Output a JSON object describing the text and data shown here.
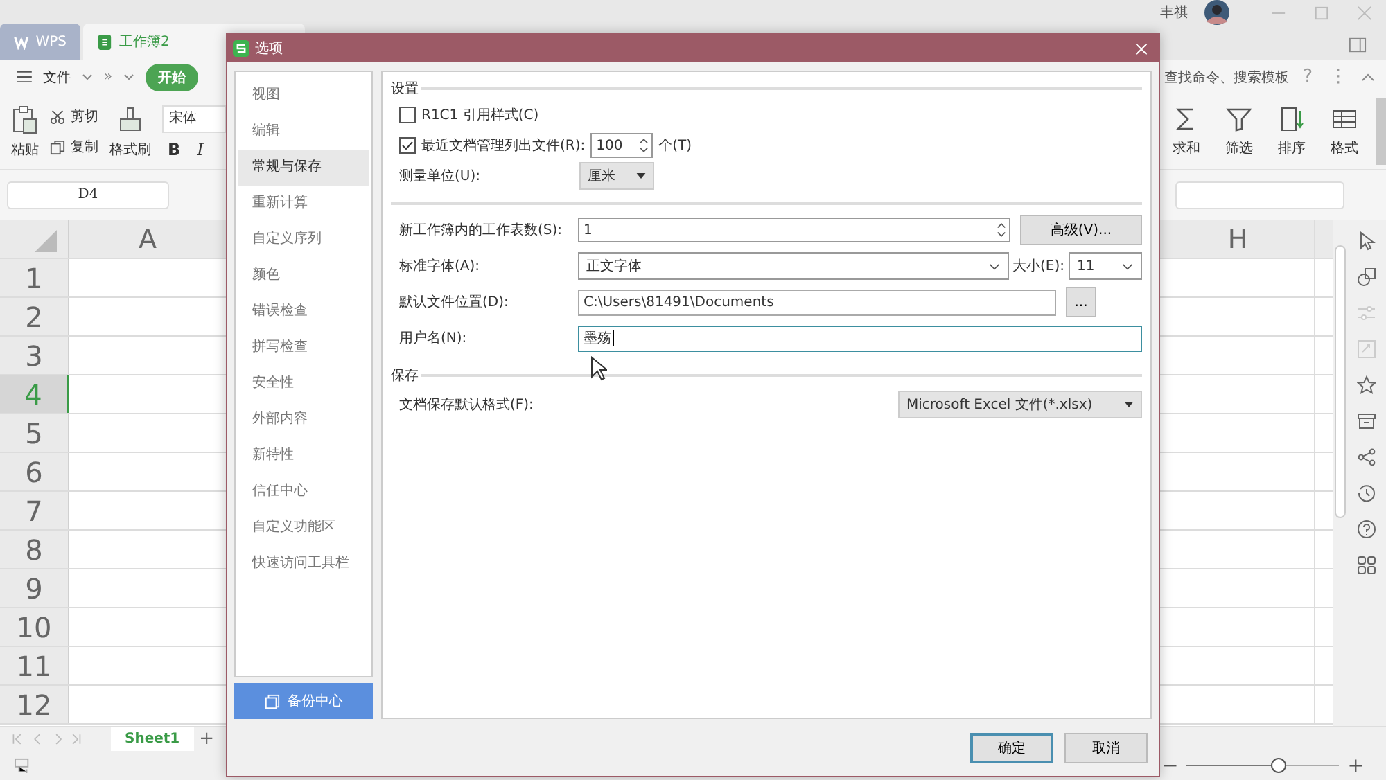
{
  "app": {
    "tabs": [
      {
        "label": "WPS",
        "kind": "home",
        "selected": false
      },
      {
        "label": "工作簿2",
        "kind": "sheet",
        "selected": true
      }
    ],
    "user": "丰祺",
    "menu": {
      "file": "文件",
      "more": "»",
      "start": "开始",
      "search": "查找命令、搜索模板",
      "help": "?",
      "options": "⋮"
    },
    "clipboard": {
      "paste": "粘贴",
      "cut": "剪切",
      "copy": "复制",
      "format_painter": "格式刷"
    },
    "font": {
      "name": "宋体",
      "bold": "B",
      "italic": "I"
    },
    "tools": [
      {
        "label": "求和",
        "kind": "sum"
      },
      {
        "label": "筛选",
        "kind": "filter"
      },
      {
        "label": "排序",
        "kind": "sort"
      },
      {
        "label": "格式",
        "kind": "format"
      }
    ],
    "name_box": "D4",
    "columns": [
      "A",
      "H"
    ],
    "rows": [
      {
        "label": "1",
        "selected": false
      },
      {
        "label": "2",
        "selected": false
      },
      {
        "label": "3",
        "selected": false
      },
      {
        "label": "4",
        "selected": true
      },
      {
        "label": "5",
        "selected": false
      },
      {
        "label": "6",
        "selected": false
      },
      {
        "label": "7",
        "selected": false
      },
      {
        "label": "8",
        "selected": false
      },
      {
        "label": "9",
        "selected": false
      },
      {
        "label": "10",
        "selected": false
      },
      {
        "label": "11",
        "selected": false
      },
      {
        "label": "12",
        "selected": false
      }
    ],
    "sheets": [
      {
        "label": "Sheet1",
        "selected": true
      }
    ],
    "add_sheet": "+",
    "zoom": {
      "minus": "−",
      "plus": "+",
      "level": 0.6
    }
  },
  "dialog": {
    "title": "选项",
    "nav": [
      {
        "label": "视图",
        "selected": false
      },
      {
        "label": "编辑",
        "selected": false
      },
      {
        "label": "常规与保存",
        "selected": true
      },
      {
        "label": "重新计算",
        "selected": false
      },
      {
        "label": "自定义序列",
        "selected": false
      },
      {
        "label": "颜色",
        "selected": false
      },
      {
        "label": "错误检查",
        "selected": false
      },
      {
        "label": "拼写检查",
        "selected": false
      },
      {
        "label": "安全性",
        "selected": false
      },
      {
        "label": "外部内容",
        "selected": false
      },
      {
        "label": "新特性",
        "selected": false
      },
      {
        "label": "信任中心",
        "selected": false
      },
      {
        "label": "自定义功能区",
        "selected": false
      },
      {
        "label": "快速访问工具栏",
        "selected": false
      }
    ],
    "backup": "备份中心",
    "settings_section": "设置",
    "r1c1": {
      "label": "R1C1 引用样式(C)",
      "checked": false
    },
    "recent": {
      "label": "最近文档管理列出文件(R):",
      "checked": true,
      "value": "100",
      "unit": "个(T)"
    },
    "measure": {
      "label": "测量单位(U):",
      "value": "厘米"
    },
    "sheet_count": {
      "label": "新工作簿内的工作表数(S):",
      "value": "1"
    },
    "advanced": "高级(V)...",
    "font": {
      "label": "标准字体(A):",
      "value": "正文字体",
      "size_label": "大小(E):",
      "size": "11"
    },
    "location": {
      "label": "默认文件位置(D):",
      "value": "C:\\Users\\81491\\Documents",
      "browse": "..."
    },
    "username": {
      "label": "用户名(N):",
      "value": "墨殇",
      "focused": true
    },
    "save_section": "保存",
    "save_format": {
      "label": "文档保存默认格式(F):",
      "value": "Microsoft Excel 文件(*.xlsx)"
    },
    "ok": "确定",
    "cancel": "取消"
  }
}
